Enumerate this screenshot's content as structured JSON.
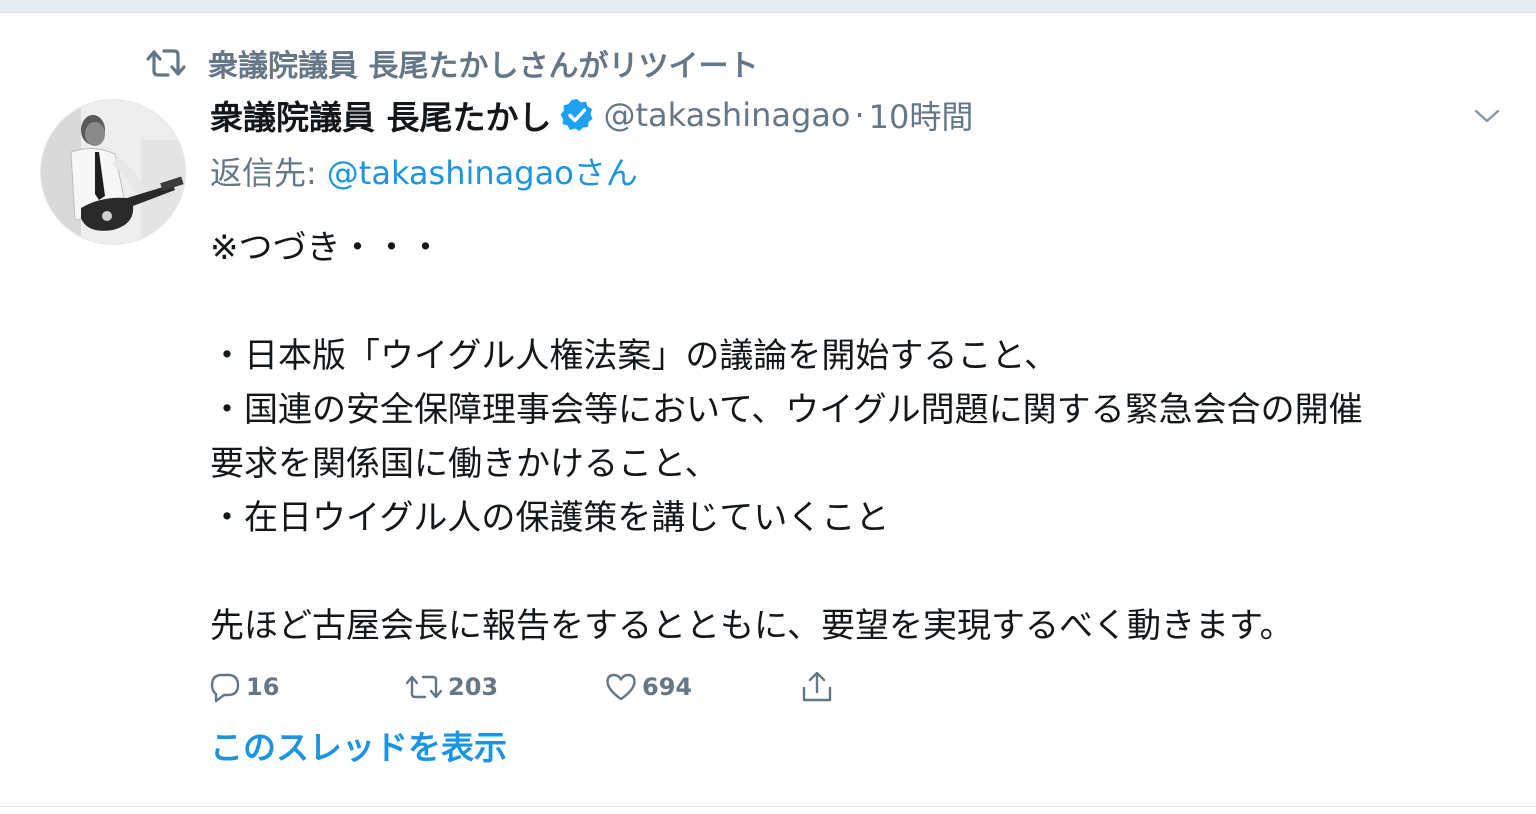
{
  "retweet_context": {
    "text": "衆議院議員 長尾たかしさんがリツイート",
    "icon": "retweet-icon"
  },
  "tweet": {
    "author_name": "衆議院議員 長尾たかし",
    "verified": true,
    "handle": "@takashinagao",
    "separator": "·",
    "time": "10時間",
    "reply_to_label": "返信先:",
    "reply_to_handle": "@takashinagaoさん",
    "body_lines": [
      "※つづき・・・",
      "",
      "・日本版「ウイグル人権法案」の議論を開始すること、",
      "・国連の安全保障理事会等において、ウイグル問題に関する緊急会合の開催",
      "要求を関係国に働きかけること、",
      "・在日ウイグル人の保護策を講じていくこと",
      "",
      "先ほど古屋会長に報告をするとともに、要望を実現するべく動きます。"
    ]
  },
  "actions": {
    "reply_count": "16",
    "retweet_count": "203",
    "like_count": "694"
  },
  "thread_link": "このスレッドを表示",
  "colors": {
    "accent": "#1b95e0",
    "muted": "#657786",
    "text": "#14171a",
    "border": "#e1e8ed"
  }
}
